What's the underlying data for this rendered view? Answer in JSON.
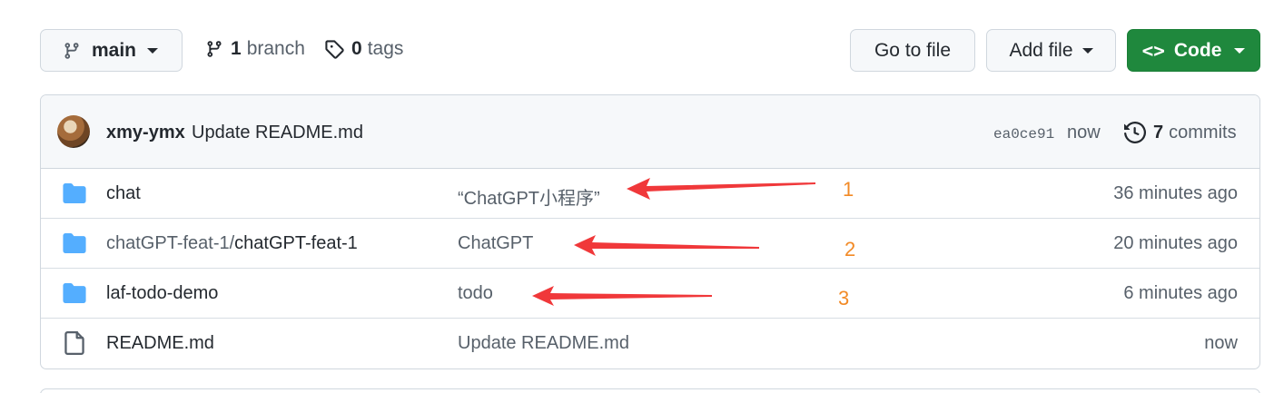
{
  "toolbar": {
    "branch_label": "main",
    "branches_count": "1",
    "branches_label": "branch",
    "tags_count": "0",
    "tags_label": "tags",
    "goto_file_label": "Go to file",
    "add_file_label": "Add file",
    "code_label": "Code"
  },
  "latest_commit": {
    "author": "xmy-ymx",
    "message": "Update README.md",
    "sha": "ea0ce91",
    "time": "now",
    "commits_count": "7",
    "commits_label": "commits"
  },
  "files": [
    {
      "type": "folder",
      "name": "chat",
      "name_prefix": "",
      "message": "“ChatGPT小程序”",
      "time": "36 minutes ago"
    },
    {
      "type": "folder",
      "name": "chatGPT-feat-1",
      "name_prefix": "chatGPT-feat-1/",
      "message": "ChatGPT",
      "time": "20 minutes ago"
    },
    {
      "type": "folder",
      "name": "laf-todo-demo",
      "name_prefix": "",
      "message": "todo",
      "time": "6 minutes ago"
    },
    {
      "type": "file",
      "name": "README.md",
      "name_prefix": "",
      "message": "Update README.md",
      "time": "now"
    }
  ],
  "annotations": {
    "numbers": [
      "1",
      "2",
      "3"
    ],
    "arrow_color": "#f0383a",
    "number_color": "#f28a26"
  },
  "colors": {
    "primary_button": "#1f883d",
    "folder_icon": "#54aeff"
  }
}
